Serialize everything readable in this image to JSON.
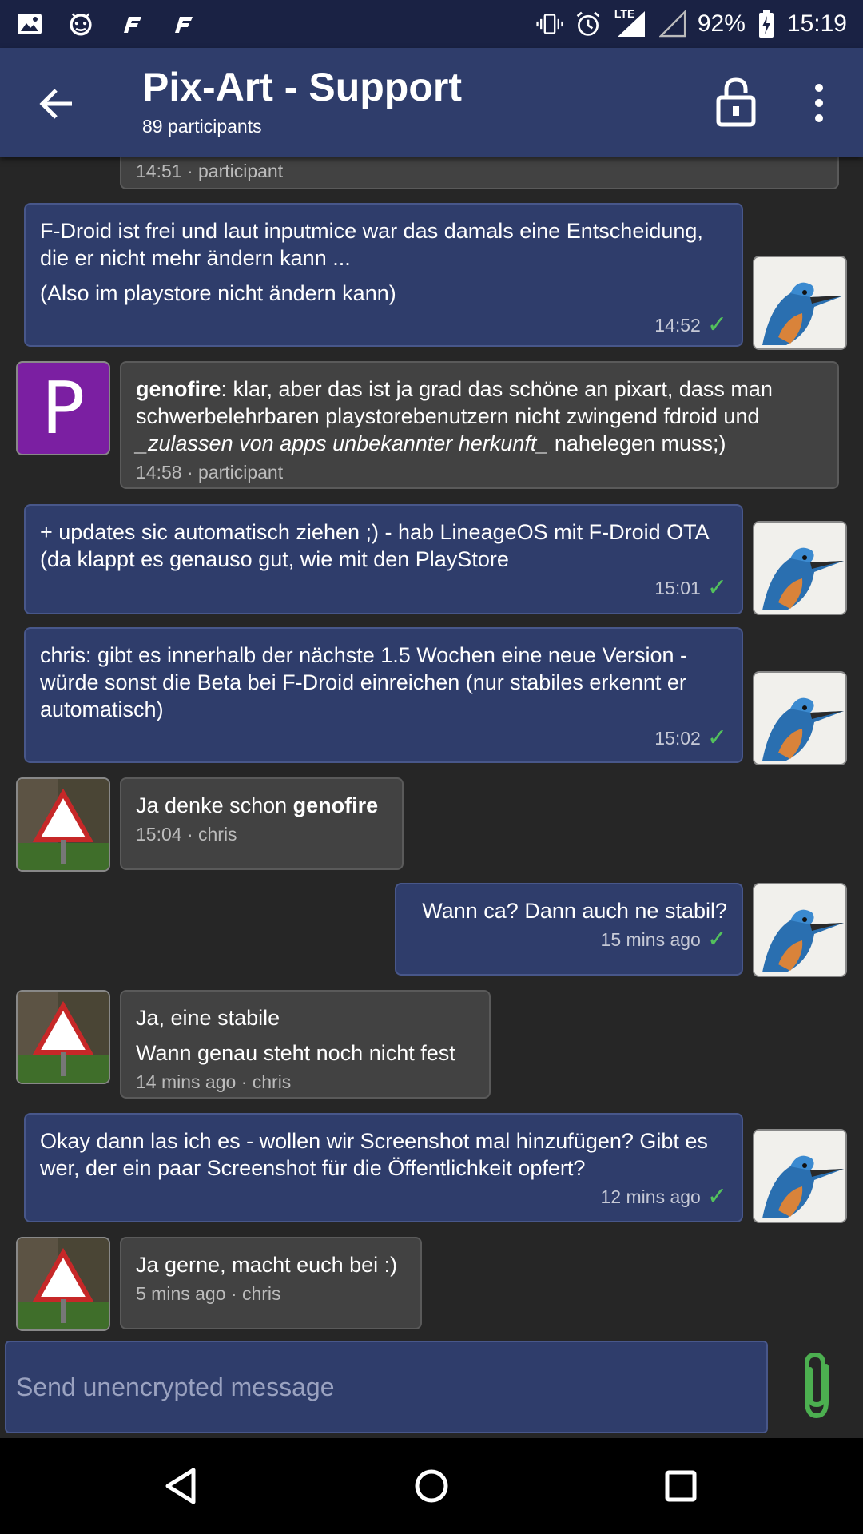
{
  "status_bar": {
    "battery": "92%",
    "time": "15:19",
    "network": "LTE",
    "left_icons": [
      "image-icon",
      "android-debug-icon",
      "fdroid-icon",
      "fdroid-icon"
    ],
    "right_icons": [
      "vibrate-icon",
      "alarm-icon",
      "signal-icon",
      "signal-empty-icon",
      "battery-charging-icon"
    ]
  },
  "app_bar": {
    "title": "Pix-Art - Support",
    "subtitle": "89 participants"
  },
  "messages": [
    {
      "id": "m0",
      "direction": "in",
      "meta": "14:51 · participant"
    },
    {
      "id": "m1",
      "direction": "out",
      "lines": [
        "F-Droid ist frei und laut inputmice war das damals eine Entscheidung, die er nicht mehr ändern kann ...",
        "(Also im playstore nicht ändern kann)"
      ],
      "time": "14:52"
    },
    {
      "id": "m2",
      "direction": "in",
      "sender_bold": "genofire",
      "text_after_sender": ": klar, aber das ist ja grad das schöne an pixart, dass man schwerbelehrbaren playstorebenutzern nicht zwingend fdroid und ",
      "italic": "_zulassen von apps unbekannter herkunft_",
      "text_end": " nahelegen muss;)",
      "meta": "14:58 · participant",
      "avatar_letter": "P"
    },
    {
      "id": "m3",
      "direction": "out",
      "lines": [
        "+ updates sic automatisch ziehen ;) - hab LineageOS mit F-Droid OTA (da klappt es genauso gut, wie mit den PlayStore"
      ],
      "time": "15:01"
    },
    {
      "id": "m4",
      "direction": "out",
      "lines": [
        "chris: gibt es innerhalb der nächste 1.5 Wochen eine neue Version - würde sonst die Beta bei F-Droid einreichen (nur stabiles erkennt er automatisch)"
      ],
      "time": "15:02"
    },
    {
      "id": "m5",
      "direction": "in",
      "text_before_bold": "Ja denke schon ",
      "bold": "genofire",
      "meta": "15:04 · chris"
    },
    {
      "id": "m6",
      "direction": "out",
      "lines": [
        "Wann ca? Dann auch ne stabil?"
      ],
      "time": "15 mins ago"
    },
    {
      "id": "m7",
      "direction": "in",
      "lines": [
        "Ja, eine stabile",
        "Wann genau steht noch nicht fest"
      ],
      "meta": "14 mins ago · chris"
    },
    {
      "id": "m8",
      "direction": "out",
      "lines": [
        "Okay dann las ich es - wollen wir Screenshot mal hinzufügen? Gibt es wer, der ein paar Screenshot für die Öffentlichkeit opfert?"
      ],
      "time": "12 mins ago"
    },
    {
      "id": "m9",
      "direction": "in",
      "lines": [
        "Ja gerne, macht euch bei :)"
      ],
      "meta": "5 mins ago · chris"
    }
  ],
  "composer": {
    "placeholder": "Send unencrypted message"
  },
  "colors": {
    "status_bar": "#1a2244",
    "app_bar": "#2f3d6b",
    "background": "#262626",
    "bubble_out": "#2f3d6b",
    "bubble_in": "#424242",
    "check": "#53c15c",
    "attach": "#4caf50",
    "avatar_p": "#7b1fa2"
  }
}
